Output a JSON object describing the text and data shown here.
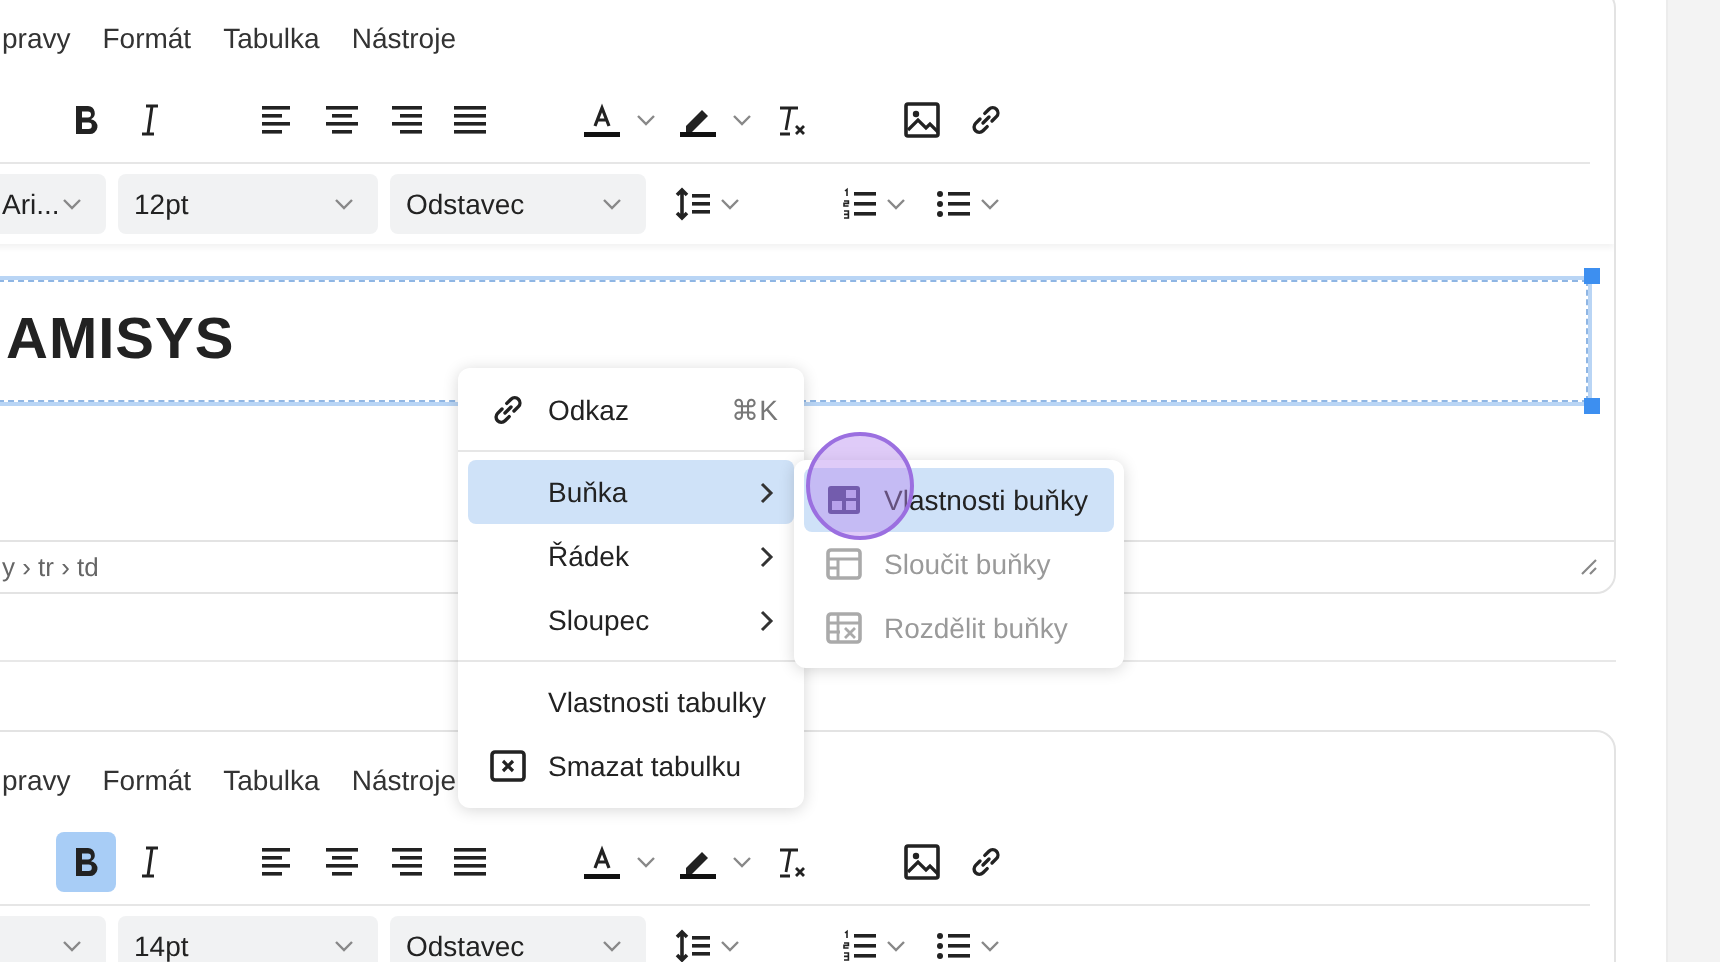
{
  "editors": [
    {
      "menubar": [
        "pravy",
        "Formát",
        "Tabulka",
        "Nástroje"
      ],
      "toolbar": [
        {
          "kind": "bold",
          "active": false
        },
        {
          "kind": "italic",
          "active": false
        },
        {
          "kind": "align-left",
          "active": false
        },
        {
          "kind": "align-center",
          "active": false
        },
        {
          "kind": "align-right",
          "active": false
        },
        {
          "kind": "justify",
          "active": false
        },
        {
          "kind": "text-color",
          "active": false
        },
        {
          "kind": "highlight",
          "active": false
        },
        {
          "kind": "clear-format",
          "active": false
        },
        {
          "kind": "image",
          "active": false
        },
        {
          "kind": "link",
          "active": false
        }
      ],
      "selects": [
        {
          "kind": "font",
          "value": "Ari..."
        },
        {
          "kind": "size",
          "value": "12pt"
        },
        {
          "kind": "block",
          "value": "Odstavec"
        }
      ],
      "toolbar2": [
        {
          "kind": "line-height"
        },
        {
          "kind": "numbered-list"
        },
        {
          "kind": "bullet-list"
        }
      ],
      "content": {
        "heading": "AMISYS"
      },
      "status_path": "y › tr › td"
    },
    {
      "menubar": [
        "pravy",
        "Formát",
        "Tabulka",
        "Nástroje"
      ],
      "toolbar": [
        {
          "kind": "bold",
          "active": true
        },
        {
          "kind": "italic",
          "active": false
        },
        {
          "kind": "align-left",
          "active": false
        },
        {
          "kind": "align-center",
          "active": false
        },
        {
          "kind": "align-right",
          "active": false
        },
        {
          "kind": "justify",
          "active": false
        },
        {
          "kind": "text-color",
          "active": false
        },
        {
          "kind": "highlight",
          "active": false
        },
        {
          "kind": "clear-format",
          "active": false
        },
        {
          "kind": "image",
          "active": false
        },
        {
          "kind": "link",
          "active": false
        }
      ],
      "selects": [
        {
          "kind": "font"
        },
        {
          "kind": "size",
          "value": "14pt"
        },
        {
          "kind": "block",
          "value": "Odstavec"
        }
      ],
      "toolbar2": [
        {
          "kind": "line-height"
        },
        {
          "kind": "numbered-list"
        },
        {
          "kind": "bullet-list"
        }
      ]
    }
  ],
  "context_menu": {
    "items": [
      {
        "kind": "item",
        "label": "Odkaz",
        "shortcut": "⌘K",
        "submenu": false,
        "selected": false
      },
      {
        "kind": "divider"
      },
      {
        "kind": "item",
        "label": "Buňka",
        "submenu": true,
        "selected": true
      },
      {
        "kind": "item",
        "label": "Řádek",
        "submenu": true,
        "selected": false
      },
      {
        "kind": "item",
        "label": "Sloupec",
        "submenu": true,
        "selected": false
      },
      {
        "kind": "divider"
      },
      {
        "kind": "item",
        "label": "Vlastnosti tabulky",
        "submenu": false,
        "selected": false
      },
      {
        "kind": "item",
        "label": "Smazat tabulku",
        "submenu": false,
        "selected": false
      }
    ]
  },
  "submenu": {
    "items": [
      {
        "label": "Vlastnosti buňky",
        "selected": true,
        "disabled": false
      },
      {
        "label": "Sloučit buňky",
        "selected": false,
        "disabled": true
      },
      {
        "label": "Rozdělit buňky",
        "selected": false,
        "disabled": true
      }
    ]
  }
}
